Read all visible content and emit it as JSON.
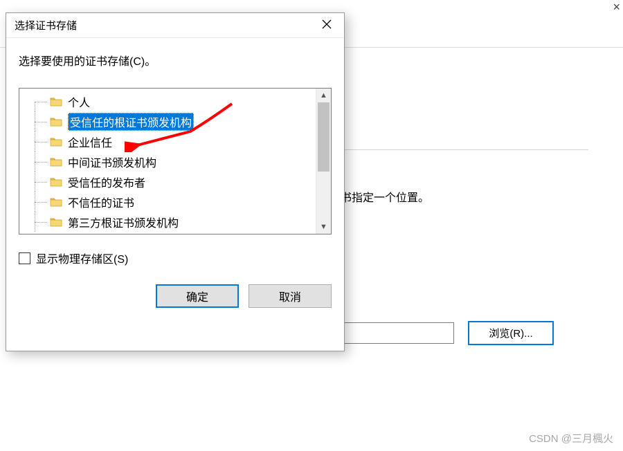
{
  "background": {
    "hint_text": "书指定一个位置。",
    "browse_label": "浏览(R)..."
  },
  "dialog": {
    "title": "选择证书存储",
    "prompt": "选择要使用的证书存储(C)。",
    "tree_items": [
      "个人",
      "受信任的根证书颁发机构",
      "企业信任",
      "中间证书颁发机构",
      "受信任的发布者",
      "不信任的证书",
      "第三方根证书颁发机构"
    ],
    "selected_index": 1,
    "show_physical_label": "显示物理存储区(S)",
    "show_physical_checked": false,
    "ok_label": "确定",
    "cancel_label": "取消"
  },
  "watermark": "CSDN @三月楓火"
}
